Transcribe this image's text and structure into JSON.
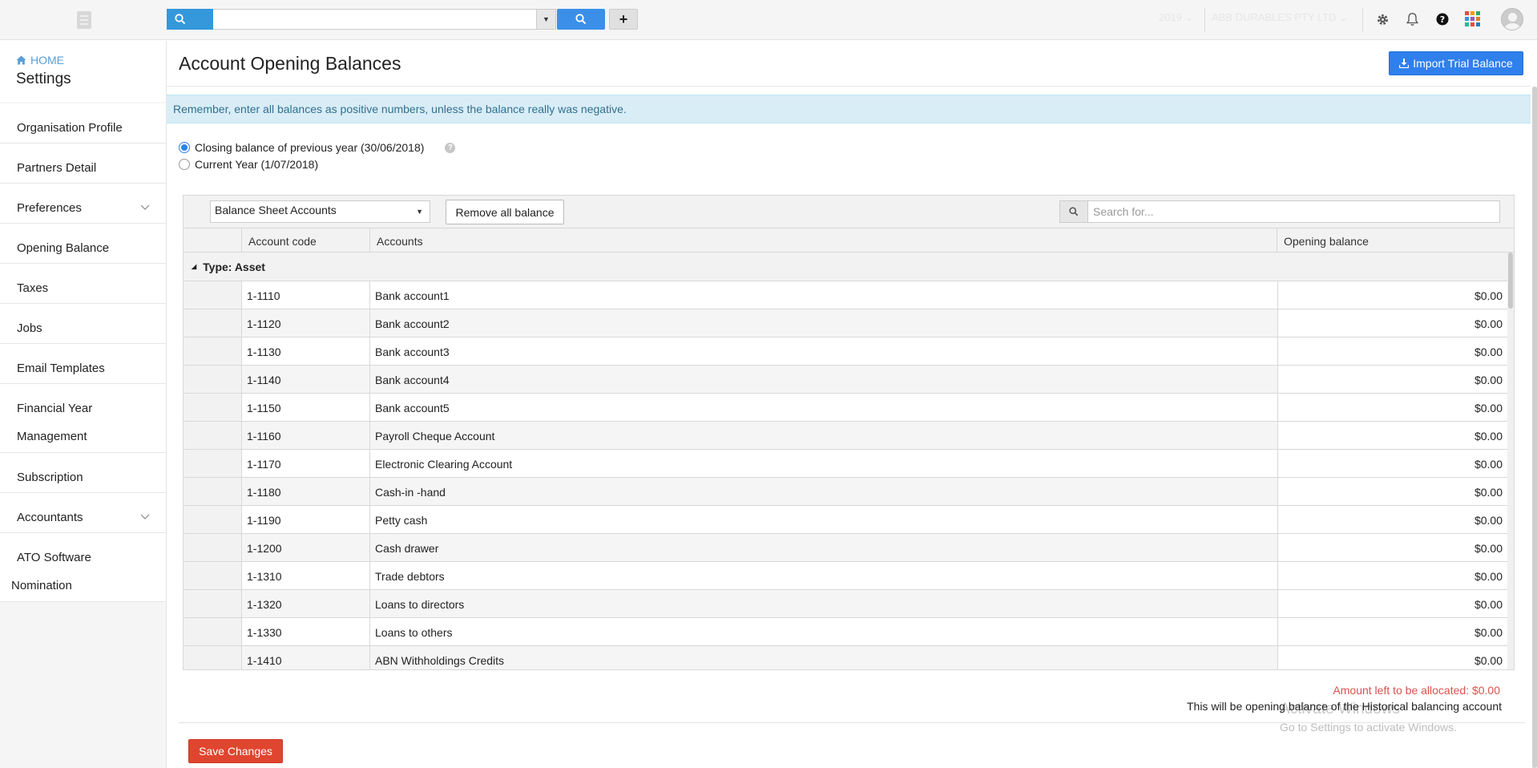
{
  "topbar": {
    "search_value": "",
    "year": "2019",
    "company": "ABB DURABLES PTY LTD"
  },
  "sidebar": {
    "home_label": "HOME",
    "title": "Settings",
    "items": [
      {
        "label": "Organisation Profile"
      },
      {
        "label": "Partners Detail"
      },
      {
        "label": "Preferences"
      },
      {
        "label": "Opening Balance"
      },
      {
        "label": "Taxes"
      },
      {
        "label": "Jobs"
      },
      {
        "label": "Email Templates"
      },
      {
        "label": "Financial Year",
        "label2": "Management"
      },
      {
        "label": "Subscription"
      },
      {
        "label": "Accountants"
      },
      {
        "label": "ATO Software",
        "label2": "Nomination"
      }
    ]
  },
  "main": {
    "title": "Account Opening Balances",
    "import_label": "Import Trial Balance",
    "info": "Remember, enter all balances as positive numbers, unless the balance really was negative.",
    "radio1": "Closing balance of previous year (30/06/2018)",
    "radio2": "Current Year (1/07/2018)"
  },
  "grid": {
    "account_type": "Balance Sheet Accounts",
    "remove_label": "Remove all balance",
    "search_placeholder": "Search for...",
    "columns": [
      "Account code",
      "Accounts",
      "Opening balance"
    ],
    "group": "Type: Asset",
    "rows": [
      {
        "code": "1-1110",
        "account": "Bank account1",
        "balance": "$0.00"
      },
      {
        "code": "1-1120",
        "account": "Bank account2",
        "balance": "$0.00"
      },
      {
        "code": "1-1130",
        "account": "Bank account3",
        "balance": "$0.00"
      },
      {
        "code": "1-1140",
        "account": "Bank account4",
        "balance": "$0.00"
      },
      {
        "code": "1-1150",
        "account": "Bank account5",
        "balance": "$0.00"
      },
      {
        "code": "1-1160",
        "account": "Payroll Cheque Account",
        "balance": "$0.00"
      },
      {
        "code": "1-1170",
        "account": "Electronic Clearing Account",
        "balance": "$0.00"
      },
      {
        "code": "1-1180",
        "account": "Cash-in -hand",
        "balance": "$0.00"
      },
      {
        "code": "1-1190",
        "account": "Petty cash",
        "balance": "$0.00"
      },
      {
        "code": "1-1200",
        "account": "Cash drawer",
        "balance": "$0.00"
      },
      {
        "code": "1-1310",
        "account": "Trade debtors",
        "balance": "$0.00"
      },
      {
        "code": "1-1320",
        "account": "Loans to directors",
        "balance": "$0.00"
      },
      {
        "code": "1-1330",
        "account": "Loans to others",
        "balance": "$0.00"
      },
      {
        "code": "1-1410",
        "account": "ABN Withholdings Credits",
        "balance": "$0.00"
      }
    ]
  },
  "footer": {
    "amount_left": "Amount left to be allocated: $0.00",
    "historical_note": "This will be opening balance of the Historical balancing account",
    "save_label": "Save Changes",
    "watermark_title": "Activate Windows",
    "watermark_sub": "Go to Settings to activate Windows."
  },
  "colors": {
    "primary": "#2f80ed",
    "danger": "#e0452f",
    "info_bg": "#d9edf7"
  }
}
